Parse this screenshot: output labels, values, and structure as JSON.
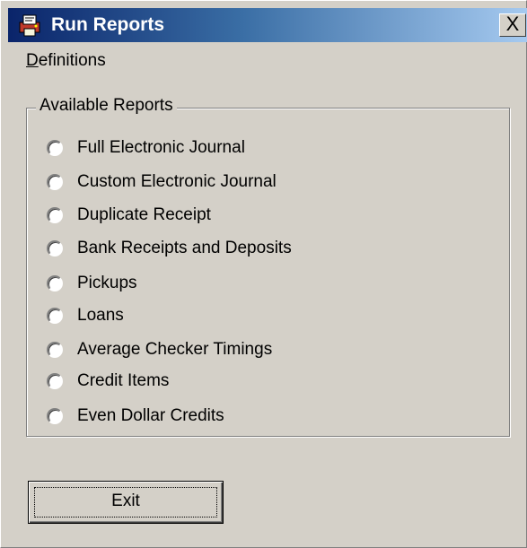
{
  "window": {
    "title": "Run Reports",
    "close_glyph": "X",
    "icon": "printer-report-icon"
  },
  "menu": {
    "definitions_accel": "D",
    "definitions_rest": "efinitions"
  },
  "available_reports": {
    "label": "Available Reports",
    "selected": null,
    "items": [
      "Full Electronic Journal",
      "Custom Electronic Journal",
      "Duplicate Receipt",
      "Bank Receipts and Deposits",
      "Pickups",
      "Loans",
      "Average Checker Timings",
      "Credit Items",
      "Even Dollar Credits"
    ]
  },
  "buttons": {
    "exit_label": "Exit"
  },
  "colors": {
    "face": "#d4d0c8",
    "title_start": "#0a246a",
    "title_end": "#a6caf0"
  }
}
